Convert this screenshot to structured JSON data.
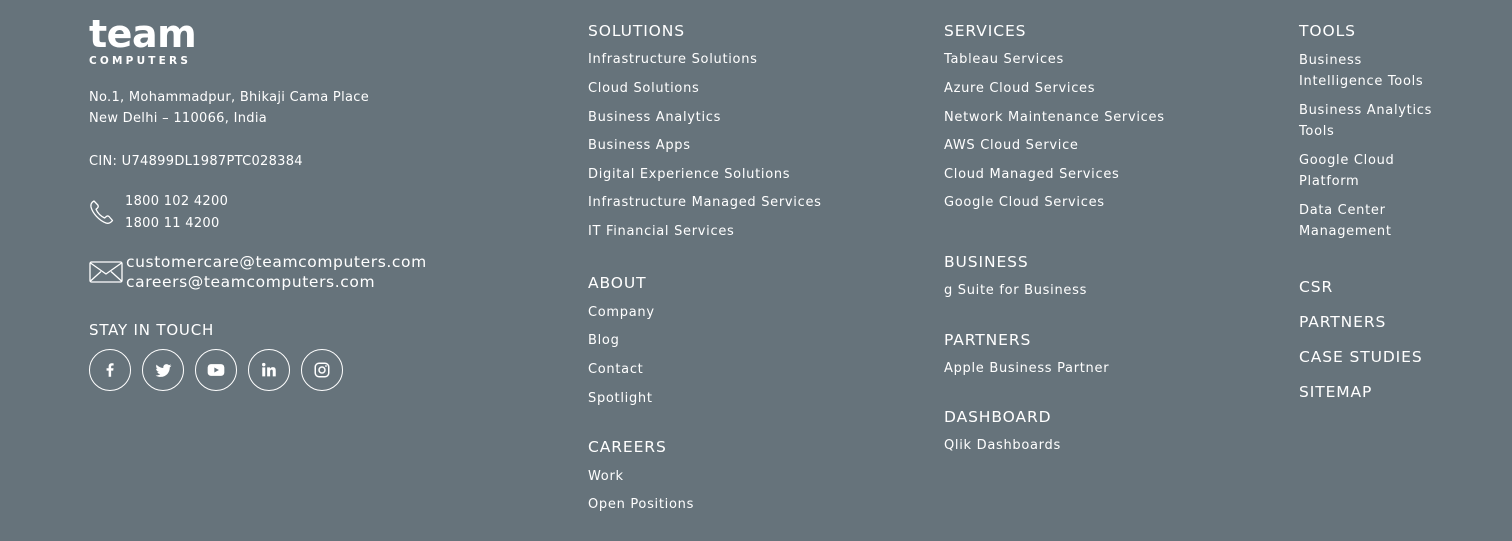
{
  "brand": {
    "name": "team",
    "sub": "COMPUTERS"
  },
  "contact": {
    "address_line1": "No.1, Mohammadpur, Bhikaji Cama Place",
    "address_line2": "New Delhi – 110066, India",
    "cin": "CIN: U74899DL1987PTC028384",
    "phone1": "1800 102 4200",
    "phone2": "1800 11 4200",
    "email1": "customercare@teamcomputers.com",
    "email2": "careers@teamcomputers.com"
  },
  "stay_in_touch": "STAY IN TOUCH",
  "social_icons": [
    "facebook-icon",
    "twitter-icon",
    "youtube-icon",
    "linkedin-icon",
    "instagram-icon"
  ],
  "solutions": {
    "title": "SOLUTIONS",
    "items": [
      "Infrastructure Solutions",
      "Cloud Solutions",
      "Business Analytics",
      "Business Apps",
      "Digital Experience Solutions",
      "Infrastructure Managed Services",
      "IT Financial Services"
    ]
  },
  "about": {
    "title": "ABOUT",
    "items": [
      "Company",
      "Blog",
      "Contact",
      "Spotlight"
    ]
  },
  "careers": {
    "title": "CAREERS",
    "items": [
      "Work",
      "Open Positions"
    ]
  },
  "services": {
    "title": "SERVICES",
    "items": [
      "Tableau Services",
      "Azure Cloud Services",
      "Network Maintenance Services",
      "AWS Cloud Service",
      "Cloud Managed Services",
      "Google Cloud Services"
    ]
  },
  "business": {
    "title": "BUSINESS",
    "items": [
      "g Suite for Business"
    ]
  },
  "partners_section": {
    "title": "PARTNERS",
    "items": [
      "Apple Business Partner"
    ]
  },
  "dashboard": {
    "title": "DASHBOARD",
    "items": [
      "Qlik Dashboards"
    ]
  },
  "tools": {
    "title": "TOOLS",
    "items": [
      [
        "Business",
        "Intelligence Tools"
      ],
      [
        "Business Analytics",
        "Tools"
      ],
      [
        "Google Cloud",
        "Platform"
      ],
      [
        "Data Center",
        "Management"
      ]
    ]
  },
  "extra_links": [
    "CSR",
    "PARTNERS",
    "CASE STUDIES",
    "SITEMAP"
  ]
}
